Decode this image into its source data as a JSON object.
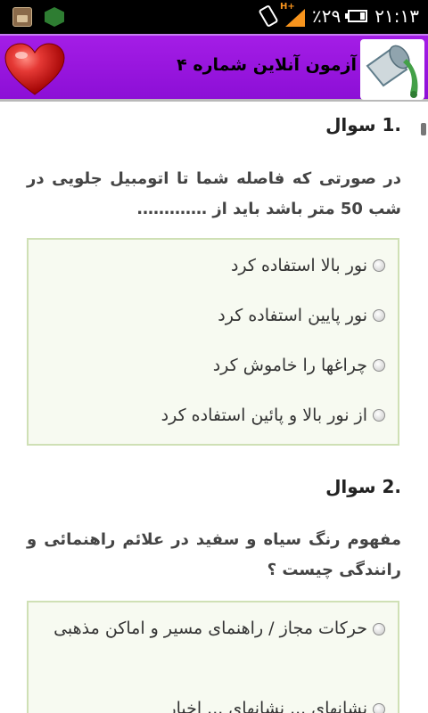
{
  "status_bar": {
    "time": "۲۱:۱۳",
    "battery_percent": "٪۲۹",
    "network_type": "H+",
    "icons": [
      "gallery-icon",
      "app-icon",
      "rotate-icon",
      "signal-icon",
      "battery-icon"
    ]
  },
  "header": {
    "title": "آزمون آنلاین شماره ۴",
    "icons": [
      "heart-icon",
      "paint-bucket-icon"
    ]
  },
  "questions": [
    {
      "title": ".1 سوال",
      "text": "در صورتی که فاصله شما تا اتومبیل جلویی در شب 50 متر باشد باید از ………….",
      "options": [
        "نور بالا استفاده کرد",
        "نور پایین استفاده کرد",
        "چراغها را خاموش کرد",
        "از نور بالا و پائین استفاده کرد"
      ]
    },
    {
      "title": ".2 سوال",
      "text": "مفهوم رنگ سیاه و سفید در علائم راهنمائی و رانندگی چیست ؟",
      "options": [
        "حرکات مجاز / راهنمای مسیر و اماکن مذهبی",
        "نشانهای ... نشانهای ... اخبار"
      ]
    }
  ],
  "colors": {
    "header_bg": "#9b16e0",
    "option_box_bg": "#f7faf1",
    "option_box_border": "#cfe0b5",
    "status_bar_bg": "#000000",
    "signal_accent": "#f7941d"
  }
}
